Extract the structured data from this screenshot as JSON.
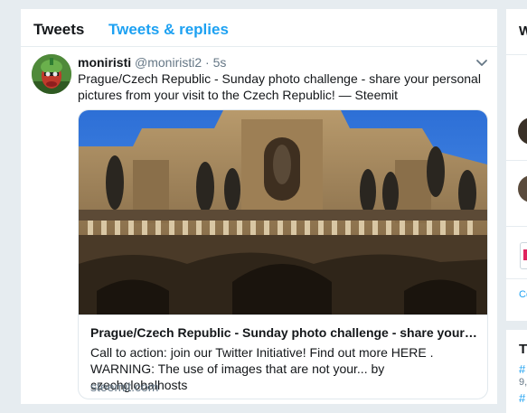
{
  "tabs": {
    "tweets": "Tweets",
    "replies": "Tweets & replies"
  },
  "tweet": {
    "name": "moniristi",
    "handle": "@moniristi2",
    "separator": "·",
    "time": "5s",
    "text": "Prague/Czech Republic - Sunday photo challenge - share your personal pictures from your visit to the Czech Republic! — Steemit",
    "card": {
      "title": "Prague/Czech Republic - Sunday photo challenge - share your p...",
      "description": "Call to action: join our Twitter Initiative! Find out more HERE . WARNING: The use of images that are not your... by czechglobalhosts",
      "domain": "steemit.com"
    }
  },
  "right_col": {
    "letter_w": "W",
    "co": "Co",
    "t": "T",
    "hash1": "#",
    "small1": "9,",
    "hash2": "#"
  },
  "colors": {
    "accent": "#1da1f2",
    "text": "#14171a",
    "muted": "#657786",
    "background": "#e6ecf0"
  },
  "icons": {
    "chevron": "chevron-down-icon",
    "avatar": "avatar"
  }
}
